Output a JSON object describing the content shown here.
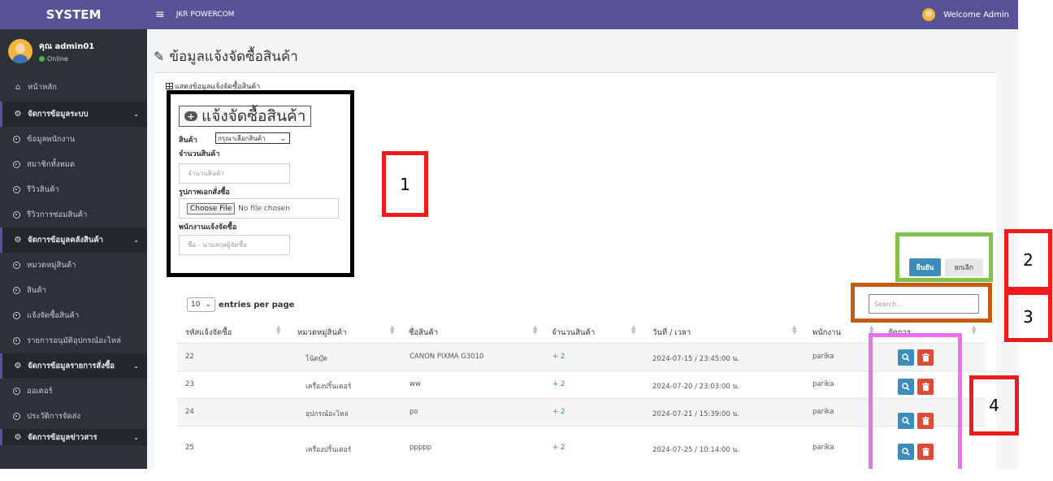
{
  "sidebar": {
    "brand": "SYSTEM",
    "user_name": "คุณ admin01",
    "user_status": "Online",
    "home": "หน้าหลัก",
    "group1": "จัดการข้อมูลระบบ",
    "g1_items": [
      "ข้อมูลพนักงาน",
      "สมาชิกทั้งหมด",
      "รีวิวสินค้า",
      "รีวิวการซ่อมสินค้า"
    ],
    "group2": "จัดการข้อมูลคลังสินค้า",
    "g2_items": [
      "หมวดหมู่สินค้า",
      "สินค้า",
      "แจ้งจัดซื้อสินค้า",
      "รายการอนุมัติอุปกรณ์อะไหล่"
    ],
    "group3": "จัดการข้อมูลรายการสั่งซื้อ",
    "g3_items": [
      "ออเดอร์",
      "ประวัติการจัดส่ง"
    ],
    "group4": "จัดการข้อมูลข่าวสาร"
  },
  "topbar": {
    "title": "JKR POWERCOM",
    "welcome": "Welcome Admin"
  },
  "page": {
    "title": "ข้อมูลแจ้งจัดซื้อสินค้า",
    "card_header": "แสดงข้อมูลแจ้งจัดซื้อสินค้า"
  },
  "form": {
    "add_label": "แจ้งจัดซื้อสินค้า",
    "product_label": "สินค้า",
    "product_select": "กรุณาเลือกสินค้า",
    "qty_label": "จำนวนสินค้า",
    "qty_placeholder": "จำนวนสินค้า",
    "image_label": "รูปภาพเอกสั่งซื้อ",
    "file_button": "Choose File",
    "file_status": "No file chosen",
    "staff_label": "พนักงานแจ้งจัดซื้อ",
    "staff_placeholder": "ชื่อ - นามสกุลผู้จัดซื้อ",
    "confirm": "ยืนยัน",
    "cancel": "ยกเลิก"
  },
  "annotations": [
    "1",
    "2",
    "3",
    "4"
  ],
  "table": {
    "entries_value": "10",
    "entries_label": "entries per page",
    "search_placeholder": "Search...",
    "headers": [
      "รหัสแจ้งจัดซื้อ",
      "หมวดหมู่สินค้า",
      "ชื่อสินค้า",
      "จำนวนสินค้า",
      "วันที่ / เวลา",
      "พนักงาน",
      "จัดการ"
    ],
    "rows": [
      [
        "22",
        "โน้ตบุ๊ค",
        "CANON PIXMA G3010",
        "+ 2",
        "2024-07-15 / 23:45:00 น.",
        "parika"
      ],
      [
        "23",
        "เครื่องปริ้นเตอร์",
        "ww",
        "+ 2",
        "2024-07-20 / 23:03:00 น.",
        "parika"
      ],
      [
        "24",
        "อุปกรณ์อะไหล่",
        "po",
        "+ 2",
        "2024-07-21 / 15:39:00 น.",
        "parika"
      ],
      [
        "25",
        "เครื่องปริ้นเตอร์",
        "ppppp",
        "+ 2",
        "2024-07-25 / 10:14:00 น.",
        "parika"
      ]
    ]
  },
  "colors": {
    "accent": "#5a5296",
    "sidebar": "#2d3238",
    "primary": "#3c8dbc",
    "danger": "#dd4b39"
  }
}
